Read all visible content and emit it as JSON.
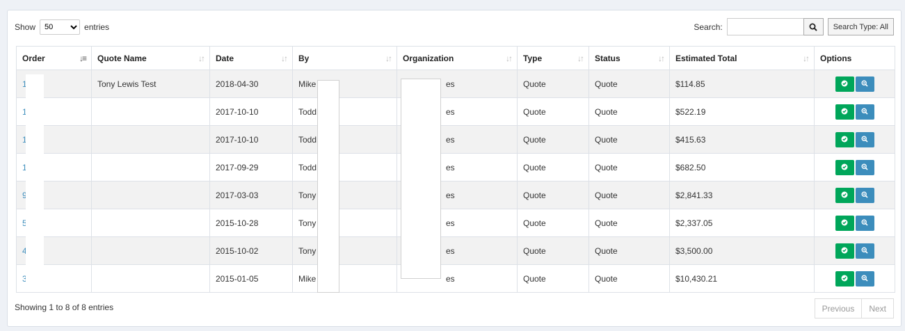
{
  "controls": {
    "show_label": "Show",
    "page_length": "50",
    "entries_label": "entries",
    "search_label": "Search:",
    "search_type_label": "Search Type: All"
  },
  "table": {
    "columns": [
      "Order",
      "Quote Name",
      "Date",
      "By",
      "Organization",
      "Type",
      "Status",
      "Estimated Total",
      "Options"
    ],
    "rows": [
      {
        "order": "11  0",
        "quote_name": "Tony Lewis Test",
        "date": "2018-04-30",
        "by": "Mike V",
        "organization": "es",
        "type": "Quote",
        "status": "Quote",
        "total": "$114.85"
      },
      {
        "order": "10  3",
        "quote_name": "",
        "date": "2017-10-10",
        "by": "Todd      nd",
        "organization": "es",
        "type": "Quote",
        "status": "Quote",
        "total": "$522.19"
      },
      {
        "order": "10  1",
        "quote_name": "",
        "date": "2017-10-10",
        "by": "Todd      nd",
        "organization": "es",
        "type": "Quote",
        "status": "Quote",
        "total": "$415.63"
      },
      {
        "order": "10  4",
        "quote_name": "",
        "date": "2017-09-29",
        "by": "Todd      nd",
        "organization": "es",
        "type": "Quote",
        "status": "Quote",
        "total": "$682.50"
      },
      {
        "order": "9",
        "quote_name": "",
        "date": "2017-03-03",
        "by": "Tony",
        "organization": "es",
        "type": "Quote",
        "status": "Quote",
        "total": "$2,841.33"
      },
      {
        "order": "5",
        "quote_name": "",
        "date": "2015-10-28",
        "by": "Tony",
        "organization": "es",
        "type": "Quote",
        "status": "Quote",
        "total": "$2,337.05"
      },
      {
        "order": "4",
        "quote_name": "",
        "date": "2015-10-02",
        "by": "Tony",
        "organization": "es",
        "type": "Quote",
        "status": "Quote",
        "total": "$3,500.00"
      },
      {
        "order": "3",
        "quote_name": "",
        "date": "2015-01-05",
        "by": "Mike V",
        "organization": "es",
        "type": "Quote",
        "status": "Quote",
        "total": "$10,430.21"
      }
    ]
  },
  "footer": {
    "info": "Showing 1 to 8 of 8 entries",
    "previous": "Previous",
    "next": "Next"
  },
  "icons": {
    "approve": "check-circle-icon",
    "view": "zoom-in-icon",
    "search": "search-icon",
    "sort": "sort-icon"
  },
  "colors": {
    "link": "#3c8dbc",
    "approve_button": "#00a65a",
    "view_button": "#3c8dbc"
  }
}
